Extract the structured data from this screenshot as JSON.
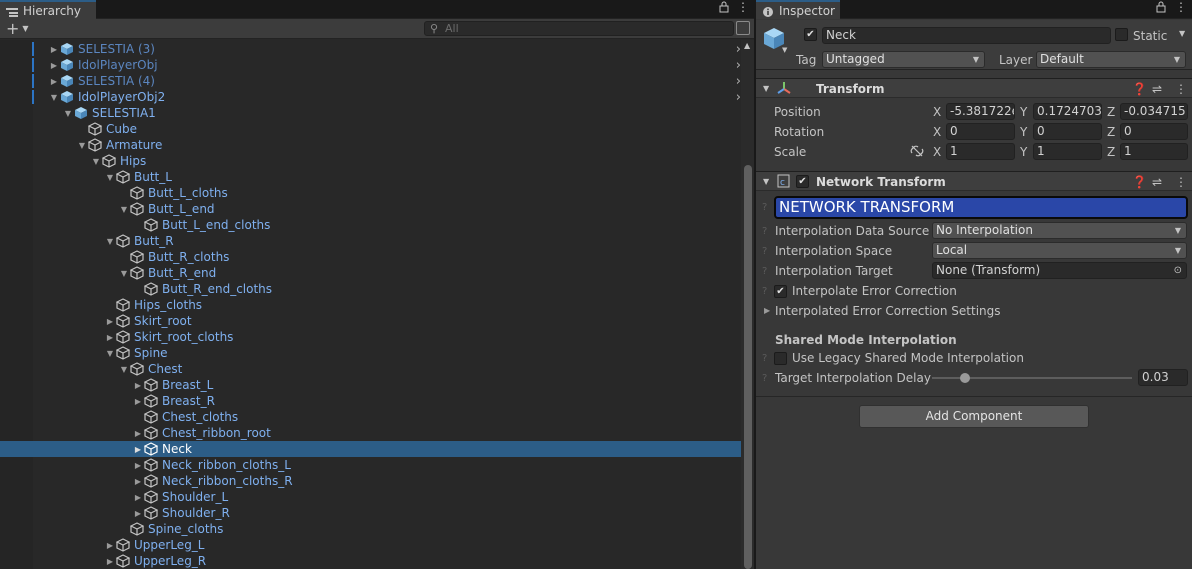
{
  "hierarchy": {
    "tab_label": "Hierarchy",
    "add_label": "+",
    "search_placeholder": "All",
    "rows": [
      {
        "label": "SELESTIA (3)",
        "depth": 0,
        "arrow": "right",
        "dim": true,
        "chevron": true,
        "selected": false
      },
      {
        "label": "IdolPlayerObj",
        "depth": 0,
        "arrow": "right",
        "dim": true,
        "chevron": true,
        "selected": false
      },
      {
        "label": "SELESTIA (4)",
        "depth": 0,
        "arrow": "right",
        "dim": true,
        "chevron": true,
        "selected": false
      },
      {
        "label": "IdolPlayerObj2",
        "depth": 0,
        "arrow": "down",
        "dim": false,
        "chevron": true,
        "selected": false
      },
      {
        "label": "SELESTIA1",
        "depth": 1,
        "arrow": "down",
        "dim": false,
        "chevron": false,
        "selected": false
      },
      {
        "label": "Cube",
        "depth": 2,
        "arrow": "",
        "dim": false,
        "chevron": false,
        "selected": false
      },
      {
        "label": "Armature",
        "depth": 2,
        "arrow": "down",
        "dim": false,
        "chevron": false,
        "selected": false
      },
      {
        "label": "Hips",
        "depth": 3,
        "arrow": "down",
        "dim": false,
        "chevron": false,
        "selected": false
      },
      {
        "label": "Butt_L",
        "depth": 4,
        "arrow": "down",
        "dim": false,
        "chevron": false,
        "selected": false
      },
      {
        "label": "Butt_L_cloths",
        "depth": 5,
        "arrow": "",
        "dim": false,
        "chevron": false,
        "selected": false
      },
      {
        "label": "Butt_L_end",
        "depth": 5,
        "arrow": "down",
        "dim": false,
        "chevron": false,
        "selected": false
      },
      {
        "label": "Butt_L_end_cloths",
        "depth": 6,
        "arrow": "",
        "dim": false,
        "chevron": false,
        "selected": false
      },
      {
        "label": "Butt_R",
        "depth": 4,
        "arrow": "down",
        "dim": false,
        "chevron": false,
        "selected": false
      },
      {
        "label": "Butt_R_cloths",
        "depth": 5,
        "arrow": "",
        "dim": false,
        "chevron": false,
        "selected": false
      },
      {
        "label": "Butt_R_end",
        "depth": 5,
        "arrow": "down",
        "dim": false,
        "chevron": false,
        "selected": false
      },
      {
        "label": "Butt_R_end_cloths",
        "depth": 6,
        "arrow": "",
        "dim": false,
        "chevron": false,
        "selected": false
      },
      {
        "label": "Hips_cloths",
        "depth": 4,
        "arrow": "",
        "dim": false,
        "chevron": false,
        "selected": false
      },
      {
        "label": "Skirt_root",
        "depth": 4,
        "arrow": "right",
        "dim": false,
        "chevron": false,
        "selected": false
      },
      {
        "label": "Skirt_root_cloths",
        "depth": 4,
        "arrow": "right",
        "dim": false,
        "chevron": false,
        "selected": false
      },
      {
        "label": "Spine",
        "depth": 4,
        "arrow": "down",
        "dim": false,
        "chevron": false,
        "selected": false
      },
      {
        "label": "Chest",
        "depth": 5,
        "arrow": "down",
        "dim": false,
        "chevron": false,
        "selected": false
      },
      {
        "label": "Breast_L",
        "depth": 6,
        "arrow": "right",
        "dim": false,
        "chevron": false,
        "selected": false
      },
      {
        "label": "Breast_R",
        "depth": 6,
        "arrow": "right",
        "dim": false,
        "chevron": false,
        "selected": false
      },
      {
        "label": "Chest_cloths",
        "depth": 6,
        "arrow": "",
        "dim": false,
        "chevron": false,
        "selected": false
      },
      {
        "label": "Chest_ribbon_root",
        "depth": 6,
        "arrow": "right",
        "dim": false,
        "chevron": false,
        "selected": false
      },
      {
        "label": "Neck",
        "depth": 6,
        "arrow": "right",
        "dim": false,
        "chevron": false,
        "selected": true
      },
      {
        "label": "Neck_ribbon_cloths_L",
        "depth": 6,
        "arrow": "right",
        "dim": false,
        "chevron": false,
        "selected": false
      },
      {
        "label": "Neck_ribbon_cloths_R",
        "depth": 6,
        "arrow": "right",
        "dim": false,
        "chevron": false,
        "selected": false
      },
      {
        "label": "Shoulder_L",
        "depth": 6,
        "arrow": "right",
        "dim": false,
        "chevron": false,
        "selected": false
      },
      {
        "label": "Shoulder_R",
        "depth": 6,
        "arrow": "right",
        "dim": false,
        "chevron": false,
        "selected": false
      },
      {
        "label": "Spine_cloths",
        "depth": 5,
        "arrow": "",
        "dim": false,
        "chevron": false,
        "selected": false
      },
      {
        "label": "UpperLeg_L",
        "depth": 4,
        "arrow": "right",
        "dim": false,
        "chevron": false,
        "selected": false
      },
      {
        "label": "UpperLeg_R",
        "depth": 4,
        "arrow": "right",
        "dim": false,
        "chevron": false,
        "selected": false
      }
    ]
  },
  "inspector": {
    "tab_label": "Inspector",
    "object_name": "Neck",
    "static_label": "Static",
    "tag_label": "Tag",
    "tag_value": "Untagged",
    "layer_label": "Layer",
    "layer_value": "Default",
    "transform": {
      "title": "Transform",
      "position_label": "Position",
      "rotation_label": "Rotation",
      "scale_label": "Scale",
      "x": "X",
      "y": "Y",
      "z": "Z",
      "position": [
        "-5.381722e",
        "0.1724703",
        "-0.034715"
      ],
      "rotation": [
        "0",
        "0",
        "0"
      ],
      "scale": [
        "1",
        "1",
        "1"
      ]
    },
    "network_transform": {
      "title": "Network Transform",
      "banner": "NETWORK TRANSFORM",
      "interp_source_label": "Interpolation Data Source",
      "interp_source_value": "No Interpolation",
      "interp_space_label": "Interpolation Space",
      "interp_space_value": "Local",
      "interp_target_label": "Interpolation Target",
      "interp_target_value": "None (Transform)",
      "error_correction_label": "Interpolate Error Correction",
      "error_settings_label": "Interpolated Error Correction Settings",
      "shared_mode_header": "Shared Mode Interpolation",
      "legacy_label": "Use Legacy Shared Mode Interpolation",
      "delay_label": "Target Interpolation Delay",
      "delay_value": "0.03"
    },
    "add_component_label": "Add Component"
  },
  "colors": {
    "selection": "#2c5d87",
    "link_text": "#7fb0ef",
    "banner": "#2a47a8"
  }
}
